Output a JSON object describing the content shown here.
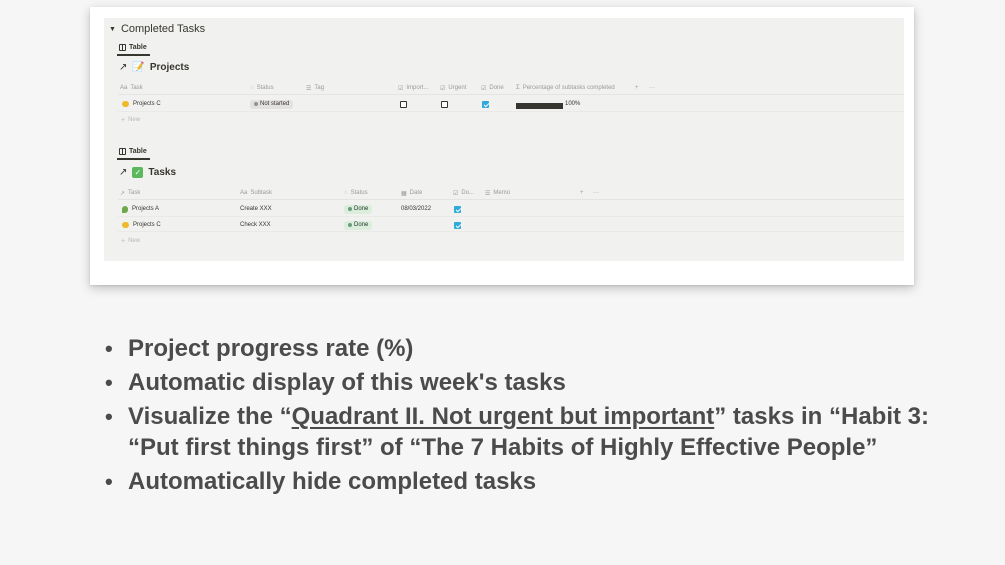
{
  "screenshot": {
    "group_title": "Completed Tasks",
    "projects_view": {
      "tab_label": "Table",
      "db_name": "Projects",
      "columns": [
        "Task",
        "Status",
        "Tag",
        "Import...",
        "Urgent",
        "Done",
        "Percentage of subtasks completed"
      ],
      "row": {
        "task": "Projects C",
        "status": "Not started",
        "important": false,
        "urgent": false,
        "done": true,
        "progress_fraction": 1.0,
        "progress_label": "100%"
      },
      "new_label": "New"
    },
    "tasks_view": {
      "tab_label": "Table",
      "db_name": "Tasks",
      "columns": [
        "Task",
        "Subtask",
        "Status",
        "Date",
        "Do...",
        "Memo"
      ],
      "rows": [
        {
          "task": "Projects A",
          "subtask": "Create XXX",
          "status": "Done",
          "date": "08/03/2022",
          "done": true
        },
        {
          "task": "Projects C",
          "subtask": "Check XXX",
          "status": "Done",
          "date": "",
          "done": true
        }
      ],
      "new_label": "New"
    },
    "add_symbol": "+",
    "more_symbol": "···"
  },
  "bullets": {
    "b1": "Project progress rate (%)",
    "b2": "Automatic display of this week's tasks",
    "b3_pre": "Visualize the “",
    "b3_link": "Quadrant II. Not urgent but important",
    "b3_post": "” tasks in “Habit 3: “Put first things first” of “The 7 Habits of Highly Effective People”",
    "b4": "Automatically hide completed tasks"
  },
  "colors": {
    "checkbox_checked": "#2eaadc",
    "status_done_bg": "#dbeddb",
    "status_not_started_bg": "#e3e2e0",
    "slide_bg": "#f6f6f6",
    "bullet_text": "#4b4b4b"
  }
}
